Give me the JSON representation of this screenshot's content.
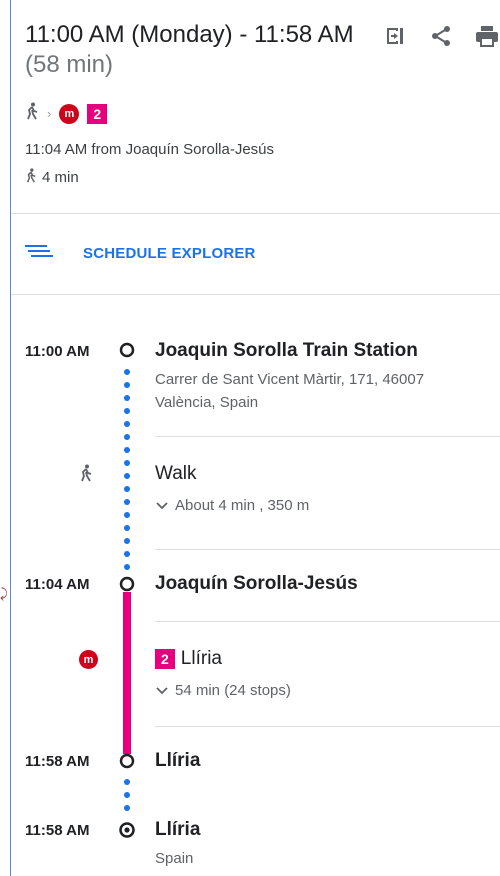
{
  "header": {
    "title_time": "11:00 AM (Monday) - 11:58 AM",
    "title_duration": "(58 min)",
    "icons": [
      "sign-in-icon",
      "share-icon",
      "print-icon"
    ],
    "route_line": "2",
    "departure": "11:04 AM from Joaquín Sorolla-Jesús",
    "walk_summary": "4 min"
  },
  "schedule": {
    "label": "SCHEDULE EXPLORER"
  },
  "steps": {
    "start": {
      "time": "11:00 AM",
      "name": "Joaquin Sorolla Train Station",
      "address_line1": "Carrer de Sant Vicent Màrtir, 171, 46007",
      "address_line2": "València, Spain"
    },
    "walk": {
      "label": "Walk",
      "detail": "About 4 min , 350 m"
    },
    "board": {
      "time": "11:04 AM",
      "name": "Joaquín Sorolla-Jesús"
    },
    "transit": {
      "line": "2",
      "headsign": "Llíria",
      "detail": "54 min (24 stops)"
    },
    "alight": {
      "time": "11:58 AM",
      "name": "Llíria"
    },
    "end": {
      "time": "11:58 AM",
      "name": "Llíria",
      "country": "Spain"
    }
  },
  "colors": {
    "accent": "#1a73e8",
    "metro_red": "#d0021b",
    "line_magenta": "#e6007e",
    "walk_dots": "#1a73e8"
  }
}
